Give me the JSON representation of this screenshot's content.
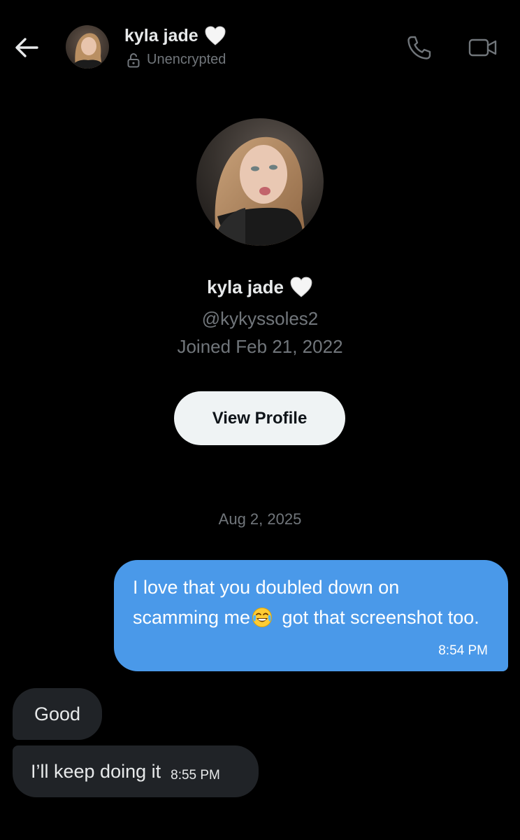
{
  "header": {
    "name": "kyla jade",
    "status": "Unencrypted"
  },
  "profile": {
    "name": "kyla jade",
    "handle": "@kykyssoles2",
    "joined": "Joined Feb 21, 2022",
    "view_profile_label": "View Profile"
  },
  "conversation": {
    "date": "Aug 2, 2025",
    "messages": [
      {
        "direction": "outgoing",
        "text_before_emoji": "I love that you doubled down on scamming me",
        "emoji": "face-with-tears-of-joy",
        "text_after_emoji": " got that screenshot too.",
        "time": "8:54 PM"
      },
      {
        "direction": "incoming",
        "text": "Good"
      },
      {
        "direction": "incoming",
        "text": "I’ll keep doing it",
        "time": "8:55 PM"
      }
    ]
  },
  "colors": {
    "background": "#000000",
    "outgoing_bubble": "#4a99e9",
    "incoming_bubble": "#202327",
    "primary_text": "#e7e9ea",
    "secondary_text": "#71767b",
    "button_bg": "#eff3f4"
  },
  "icons": {
    "back": "arrow-left-icon",
    "lock": "unlocked-padlock-icon",
    "call": "phone-icon",
    "video": "video-camera-icon",
    "heart": "white-heart-icon"
  }
}
